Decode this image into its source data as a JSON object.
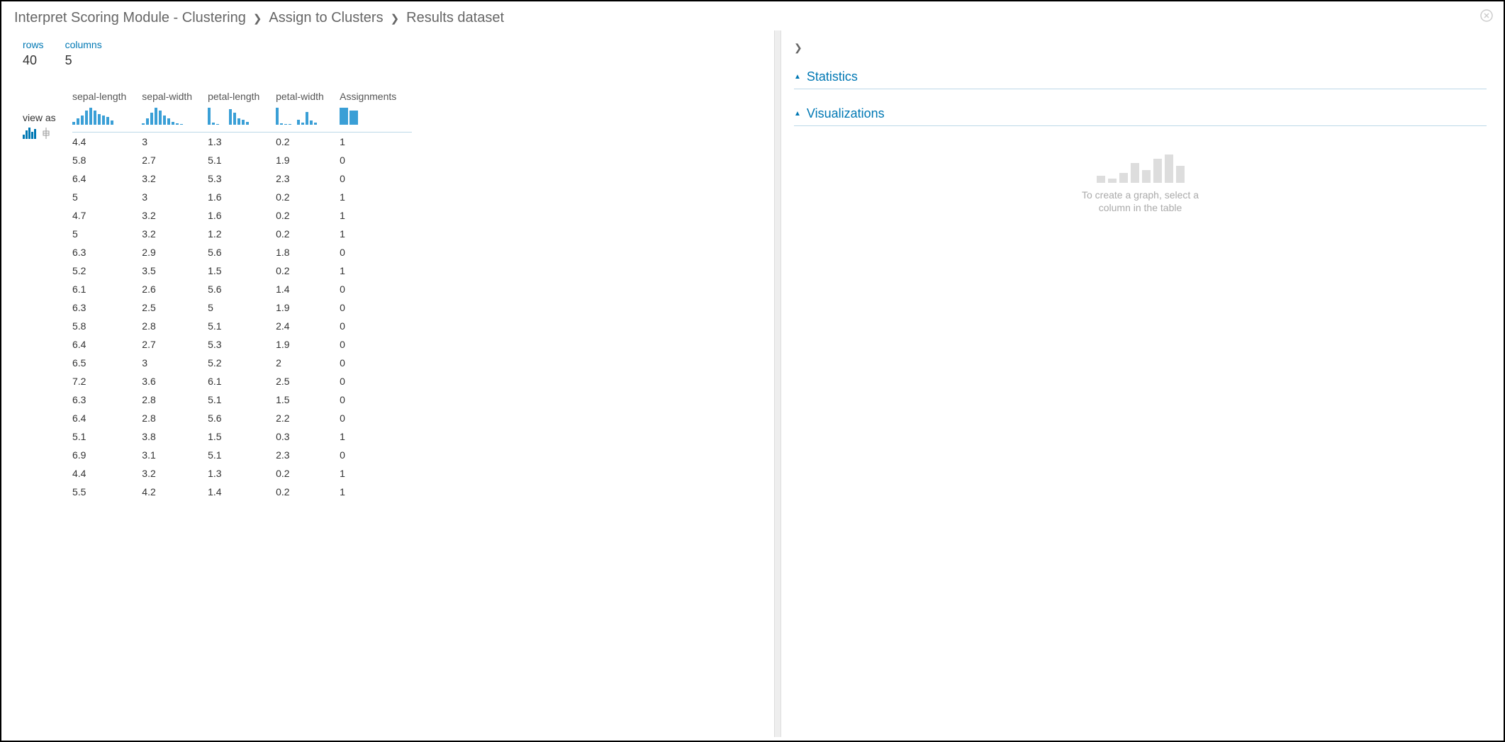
{
  "breadcrumb": {
    "item1": "Interpret Scoring Module - Clustering",
    "item2": "Assign to Clusters",
    "item3": "Results dataset"
  },
  "meta": {
    "rows_label": "rows",
    "rows_value": "40",
    "cols_label": "columns",
    "cols_value": "5"
  },
  "view_as_label": "view as",
  "columns": [
    "sepal-length",
    "sepal-width",
    "petal-length",
    "petal-width",
    "Assignments"
  ],
  "table": [
    [
      "4.4",
      "3",
      "1.3",
      "0.2",
      "1"
    ],
    [
      "5.8",
      "2.7",
      "5.1",
      "1.9",
      "0"
    ],
    [
      "6.4",
      "3.2",
      "5.3",
      "2.3",
      "0"
    ],
    [
      "5",
      "3",
      "1.6",
      "0.2",
      "1"
    ],
    [
      "4.7",
      "3.2",
      "1.6",
      "0.2",
      "1"
    ],
    [
      "5",
      "3.2",
      "1.2",
      "0.2",
      "1"
    ],
    [
      "6.3",
      "2.9",
      "5.6",
      "1.8",
      "0"
    ],
    [
      "5.2",
      "3.5",
      "1.5",
      "0.2",
      "1"
    ],
    [
      "6.1",
      "2.6",
      "5.6",
      "1.4",
      "0"
    ],
    [
      "6.3",
      "2.5",
      "5",
      "1.9",
      "0"
    ],
    [
      "5.8",
      "2.8",
      "5.1",
      "2.4",
      "0"
    ],
    [
      "6.4",
      "2.7",
      "5.3",
      "1.9",
      "0"
    ],
    [
      "6.5",
      "3",
      "5.2",
      "2",
      "0"
    ],
    [
      "7.2",
      "3.6",
      "6.1",
      "2.5",
      "0"
    ],
    [
      "6.3",
      "2.8",
      "5.1",
      "1.5",
      "0"
    ],
    [
      "6.4",
      "2.8",
      "5.6",
      "2.2",
      "0"
    ],
    [
      "5.1",
      "3.8",
      "1.5",
      "0.3",
      "1"
    ],
    [
      "6.9",
      "3.1",
      "5.1",
      "2.3",
      "0"
    ],
    [
      "4.4",
      "3.2",
      "1.3",
      "0.2",
      "1"
    ],
    [
      "5.5",
      "4.2",
      "1.4",
      "0.2",
      "1"
    ]
  ],
  "right": {
    "statistics_label": "Statistics",
    "visualizations_label": "Visualizations",
    "placeholder_line1": "To create a graph, select a",
    "placeholder_line2": "column in the table"
  },
  "histograms": {
    "sepal_length": [
      4,
      10,
      14,
      22,
      26,
      22,
      16,
      14,
      12,
      6
    ],
    "sepal_width": [
      2,
      8,
      16,
      22,
      18,
      12,
      8,
      4,
      2,
      1
    ],
    "petal_length": [
      22,
      3,
      1,
      0,
      0,
      20,
      16,
      8,
      6,
      4
    ],
    "petal_width": [
      26,
      2,
      1,
      1,
      0,
      8,
      3,
      20,
      6,
      3
    ],
    "assignments": [
      24,
      20
    ]
  },
  "chart_data": {
    "type": "table",
    "title": "Results dataset (first 20 of 40 rows)",
    "columns": [
      "sepal-length",
      "sepal-width",
      "petal-length",
      "petal-width",
      "Assignments"
    ],
    "rows": [
      [
        4.4,
        3,
        1.3,
        0.2,
        1
      ],
      [
        5.8,
        2.7,
        5.1,
        1.9,
        0
      ],
      [
        6.4,
        3.2,
        5.3,
        2.3,
        0
      ],
      [
        5,
        3,
        1.6,
        0.2,
        1
      ],
      [
        4.7,
        3.2,
        1.6,
        0.2,
        1
      ],
      [
        5,
        3.2,
        1.2,
        0.2,
        1
      ],
      [
        6.3,
        2.9,
        5.6,
        1.8,
        0
      ],
      [
        5.2,
        3.5,
        1.5,
        0.2,
        1
      ],
      [
        6.1,
        2.6,
        5.6,
        1.4,
        0
      ],
      [
        6.3,
        2.5,
        5,
        1.9,
        0
      ],
      [
        5.8,
        2.8,
        5.1,
        2.4,
        0
      ],
      [
        6.4,
        2.7,
        5.3,
        1.9,
        0
      ],
      [
        6.5,
        3,
        5.2,
        2,
        0
      ],
      [
        7.2,
        3.6,
        6.1,
        2.5,
        0
      ],
      [
        6.3,
        2.8,
        5.1,
        1.5,
        0
      ],
      [
        6.4,
        2.8,
        5.6,
        2.2,
        0
      ],
      [
        5.1,
        3.8,
        1.5,
        0.3,
        1
      ],
      [
        6.9,
        3.1,
        5.1,
        2.3,
        0
      ],
      [
        4.4,
        3.2,
        1.3,
        0.2,
        1
      ],
      [
        5.5,
        4.2,
        1.4,
        0.2,
        1
      ]
    ]
  }
}
